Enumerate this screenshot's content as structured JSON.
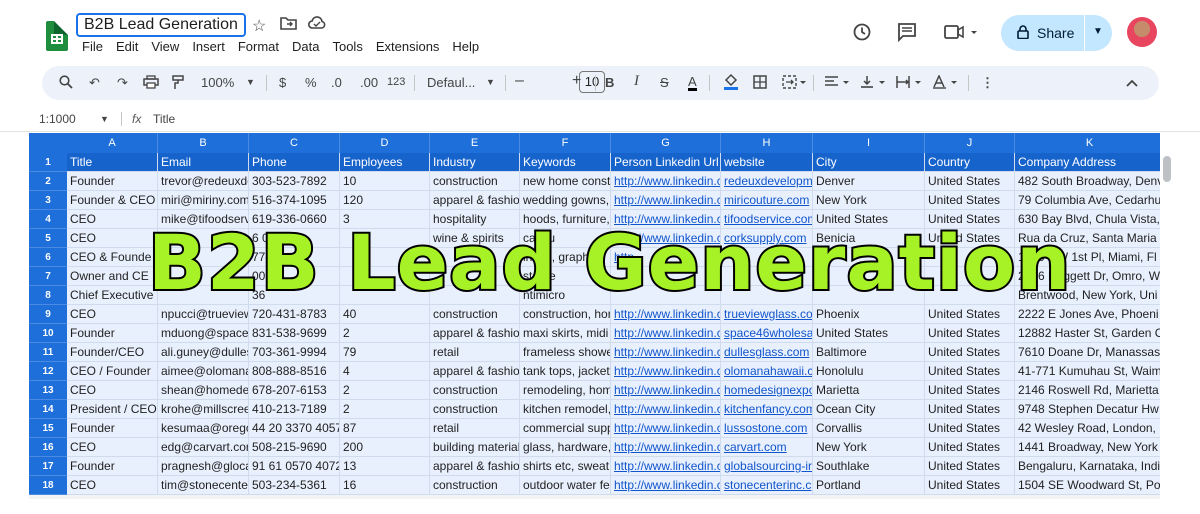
{
  "titlebar": {
    "doc_title": "B2B Lead Generation",
    "icons": [
      "star-icon",
      "move-to-folder-icon",
      "cloud-status-icon"
    ],
    "menu": [
      "File",
      "Edit",
      "View",
      "Insert",
      "Format",
      "Data",
      "Tools",
      "Extensions",
      "Help"
    ],
    "right_icons": [
      "history-icon",
      "comment-icon",
      "meet-icon"
    ],
    "share_label": "Share"
  },
  "toolbar": {
    "zoom": "100%",
    "currency": "$",
    "percent": "%",
    "decrease_decimal": ".0",
    "increase_decimal": ".00",
    "number_format": "123",
    "font": "Defaul...",
    "minus": "–",
    "font_size": "10",
    "plus": "+",
    "bold": "B",
    "italic": "I",
    "strike": "S",
    "text_color": "A"
  },
  "formula": {
    "namebox": "1:1000",
    "fx": "fx",
    "value": "Title"
  },
  "grid": {
    "columns": [
      "A",
      "B",
      "C",
      "D",
      "E",
      "F",
      "G",
      "H",
      "I",
      "J",
      "K"
    ],
    "rows": [
      "1",
      "2",
      "3",
      "4",
      "5",
      "6",
      "7",
      "8",
      "9",
      "10",
      "11",
      "12",
      "13",
      "14",
      "15",
      "16",
      "17",
      "18"
    ],
    "headers": [
      "Title",
      "Email",
      "Phone",
      "Employees",
      "Industry",
      "Keywords",
      "Person Linkedin Url",
      "website",
      "City",
      "Country",
      "Company Address"
    ],
    "data": [
      [
        "Founder",
        "trevor@redeuxde",
        "303-523-7892",
        "10",
        "construction",
        "new home const",
        "http://www.linkedin.c",
        "redeuxdevelopm",
        "Denver",
        "United States",
        "482 South Broadway, Denv"
      ],
      [
        "Founder & CEO",
        "miri@miriny.com",
        "516-374-1095",
        "120",
        "apparel & fashio",
        "wedding gowns,",
        "http://www.linkedin.c",
        "miricouture.com",
        "New York",
        "United States",
        "79 Columbia Ave, Cedarhu"
      ],
      [
        "CEO",
        "mike@tifoodserv",
        "619-336-0660",
        "3",
        "hospitality",
        "hoods, furniture,",
        "http://www.linkedin.c",
        "tifoodservice.com",
        "United States",
        "United States",
        "630 Bay Blvd, Chula Vista,"
      ],
      [
        "CEO",
        "",
        "6 035",
        "",
        "wine & spirits",
        "capsu",
        "http://www.linkedin.c",
        "corksupply.com",
        "Benicia",
        "United States",
        "Rua da Cruz, Santa Maria"
      ],
      [
        "CEO & Founde",
        "rowell",
        "774",
        "",
        "",
        "inting, graphic",
        "http",
        "",
        "",
        "",
        "1910 NW 1st Pl, Miami, Fl"
      ],
      [
        "Owner and CE",
        "",
        "00",
        "",
        "",
        "stome",
        "",
        "",
        "",
        "",
        "2016 Daggett Dr, Omro, W"
      ],
      [
        "Chief Executive",
        "",
        "36",
        "",
        "",
        "ntimicro",
        "",
        "",
        "",
        "",
        "Brentwood, New York, Uni"
      ],
      [
        "CEO",
        "npucci@trueview",
        "720-431-8783",
        "40",
        "construction",
        "construction, hor",
        "http://www.linkedin.c",
        "trueviewglass.co",
        "Phoenix",
        "United States",
        "2222 E Jones Ave, Phoeni"
      ],
      [
        "Founder",
        "mduong@space",
        "831-538-9699",
        "2",
        "apparel & fashio",
        "maxi skirts, midi",
        "http://www.linkedin.c",
        "space46wholesa",
        "United States",
        "United States",
        "12882 Haster St, Garden C"
      ],
      [
        "Founder/CEO",
        "ali.guney@dulles",
        "703-361-9994",
        "79",
        "retail",
        "frameless showe",
        "http://www.linkedin.c",
        "dullesglass.com",
        "Baltimore",
        "United States",
        "7610 Doane Dr, Manassas"
      ],
      [
        "CEO / Founder",
        "aimee@olomana",
        "808-888-8516",
        "4",
        "apparel & fashio",
        "tank tops, jacket",
        "http://www.linkedin.c",
        "olomanahawaii.c",
        "Honolulu",
        "United States",
        "41-771 Kumuhau St, Waim"
      ],
      [
        "CEO",
        "shean@homede",
        "678-207-6153",
        "2",
        "construction",
        "remodeling, hom",
        "http://www.linkedin.c",
        "homedesignexpo",
        "Marietta",
        "United States",
        "2146 Roswell Rd, Marietta"
      ],
      [
        "President / CEO",
        "krohe@millscree",
        "410-213-7189",
        "2",
        "construction",
        "kitchen remodel,",
        "http://www.linkedin.c",
        "kitchenfancy.com",
        "Ocean City",
        "United States",
        "9748 Stephen Decatur Hw"
      ],
      [
        "Founder",
        "kesumaa@orego",
        "44 20 3370 4057",
        "87",
        "retail",
        "commercial supp",
        "http://www.linkedin.c",
        "lussostone.com",
        "Corvallis",
        "United States",
        "42 Wesley Road, London,"
      ],
      [
        "CEO",
        "edg@carvart.cor",
        "508-215-9690",
        "200",
        "building material",
        "glass, hardware,",
        "http://www.linkedin.c",
        "carvart.com",
        "New York",
        "United States",
        "1441 Broadway, New York"
      ],
      [
        "Founder",
        "pragnesh@gloca",
        "91 61 0570 4072",
        "13",
        "apparel & fashio",
        "shirts etc, sweat",
        "http://www.linkedin.c",
        "globalsourcing-ir",
        "Southlake",
        "United States",
        "Bengaluru, Karnataka, Indi"
      ],
      [
        "CEO",
        "tim@stonecente",
        "503-234-5361",
        "16",
        "construction",
        "outdoor water fe",
        "http://www.linkedin.c",
        "stonecenterinc.c",
        "Portland",
        "United States",
        "1504 SE Woodward St, Po"
      ]
    ]
  },
  "overlay": {
    "text": "B2B Lead Generation"
  },
  "colors": {
    "header_blue": "#1e6fd9",
    "cell_tint": "#e8f0fd",
    "overlay_green": "#a7f226",
    "share_bg": "#c2e7ff"
  }
}
